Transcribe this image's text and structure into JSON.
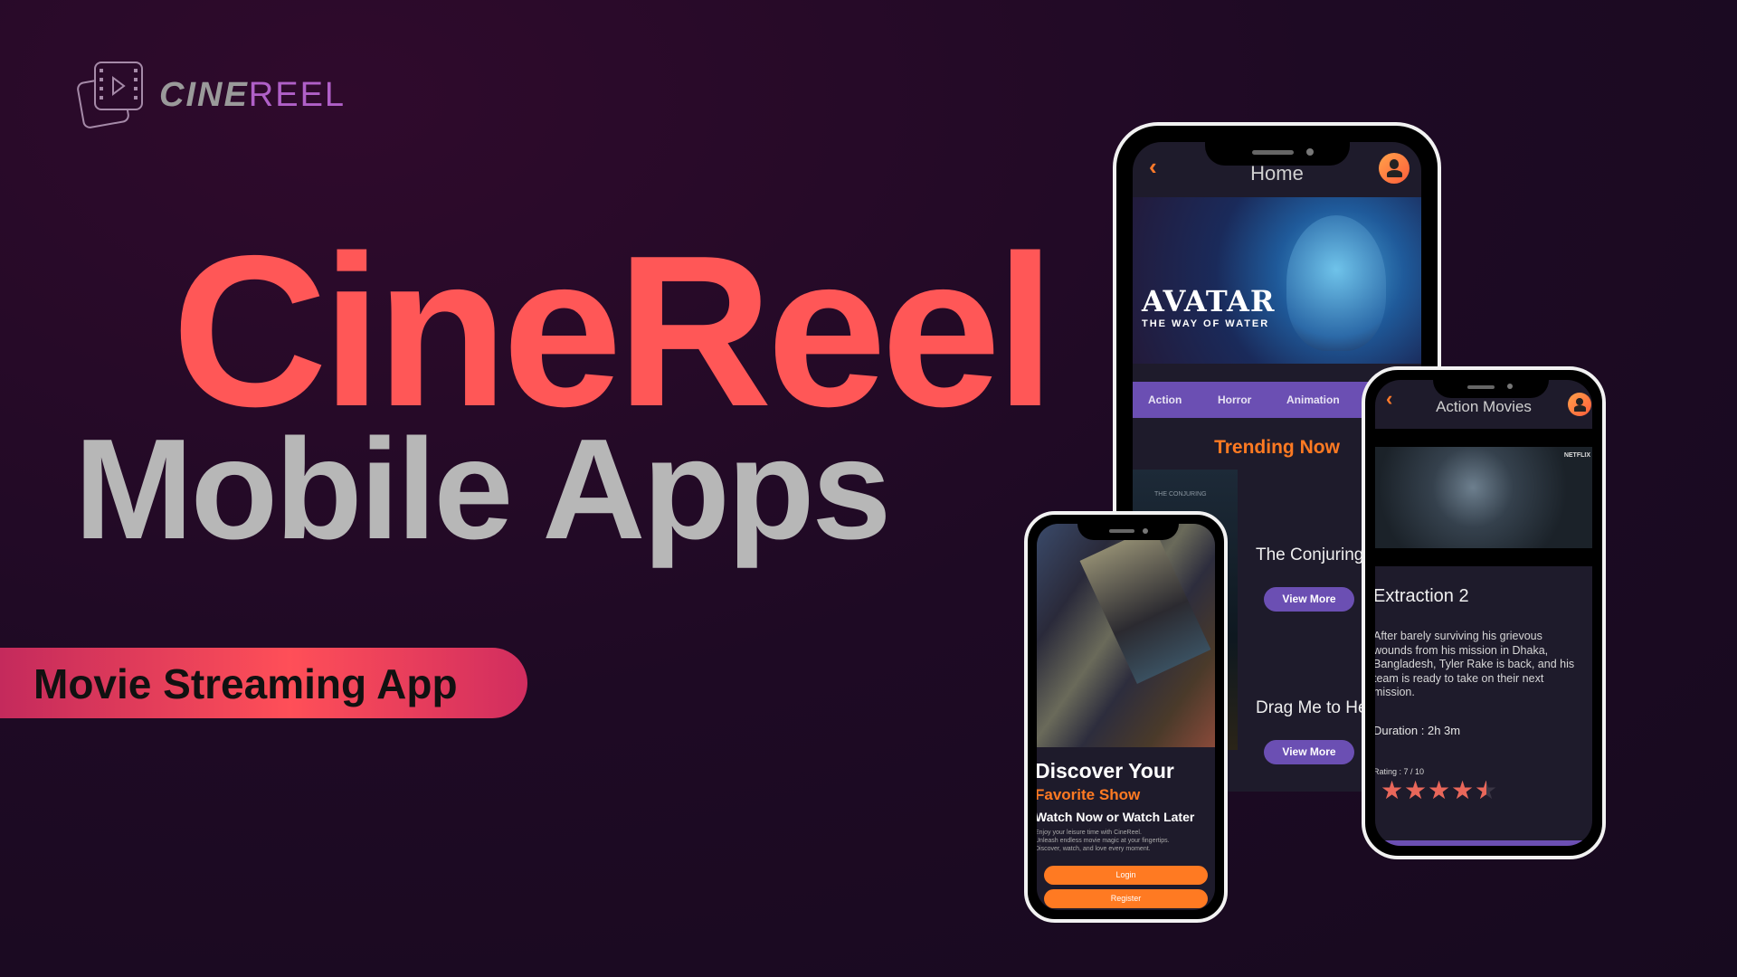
{
  "brand": {
    "logo_part1": "CINE",
    "logo_part2": "REEL",
    "logo_icon": "film-play-icon"
  },
  "hero": {
    "title": "CineReel",
    "subtitle": "Mobile Apps",
    "badge": "Movie Streaming App"
  },
  "colors": {
    "accent_red": "#ff5757",
    "accent_orange": "#ff7a22",
    "accent_purple": "#6b4fb3",
    "background": "#1e0a24"
  },
  "home_phone": {
    "title": "Home",
    "banner": {
      "title": "AVATAR",
      "subtitle": "THE WAY OF WATER"
    },
    "genres": [
      "Action",
      "Horror",
      "Animation"
    ],
    "section_title": "Trending Now",
    "items": [
      {
        "title": "The Conjuring",
        "button": "View More"
      },
      {
        "title": "Drag Me to Hell",
        "button": "View More"
      }
    ],
    "poster_text": "THE CONJURING"
  },
  "discover_phone": {
    "heading": "Discover Your",
    "heading_accent": "Favorite Show",
    "tagline": "Watch Now or Watch Later",
    "body": [
      "Enjoy your leisure time with CineReel.",
      "Unleash endless movie magic at your fingertips.",
      "Discover, watch, and love every moment."
    ],
    "login": "Login",
    "register": "Register"
  },
  "detail_phone": {
    "title": "Action Movies",
    "image_badge": "NETFLIX",
    "movie_title": "Extraction 2",
    "description": "After barely surviving his grievous wounds from his mission in Dhaka, Bangladesh, Tyler Rake is back, and his team is ready to take on their next mission.",
    "duration": "Duration : 2h 3m",
    "rating_label": "Rating : 7 / 10",
    "stars": 4.5,
    "stars_max": 5
  }
}
